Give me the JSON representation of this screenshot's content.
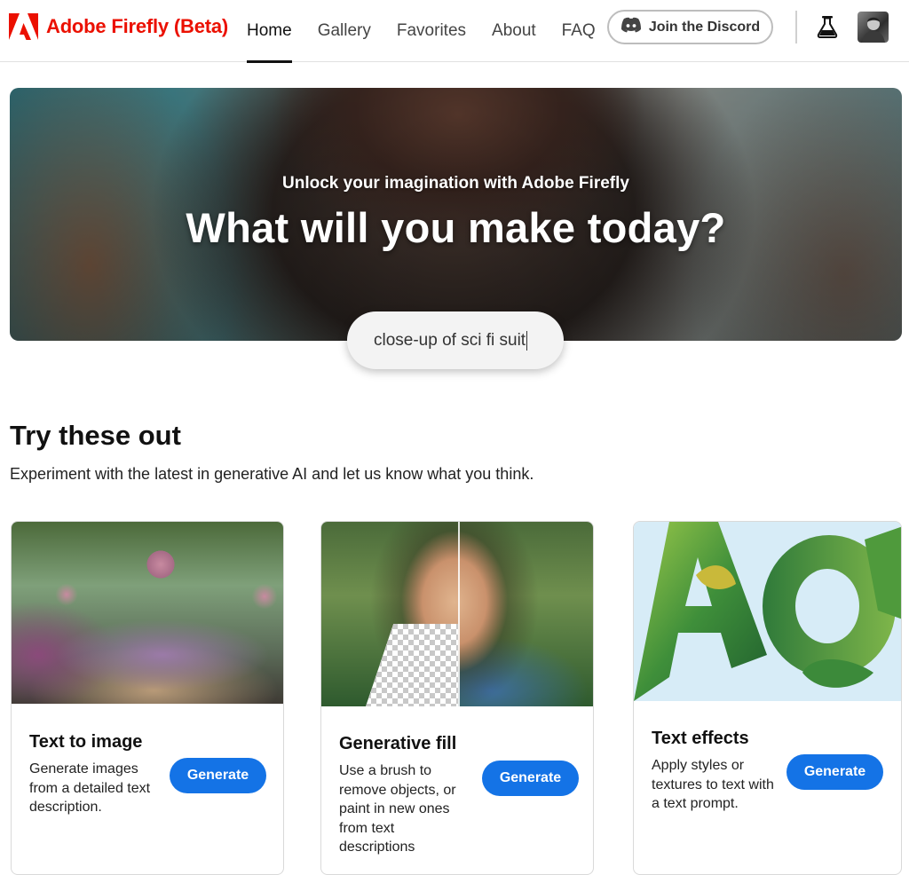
{
  "header": {
    "brand_name": "Adobe Firefly (Beta)",
    "brand_color": "#eb1000",
    "nav": [
      {
        "label": "Home",
        "active": true
      },
      {
        "label": "Gallery",
        "active": false
      },
      {
        "label": "Favorites",
        "active": false
      },
      {
        "label": "About",
        "active": false
      },
      {
        "label": "FAQ",
        "active": false
      }
    ],
    "discord_label": "Join the Discord",
    "icons": [
      "adobe-logo-icon",
      "discord-icon",
      "flask-icon",
      "avatar"
    ]
  },
  "hero": {
    "subtitle": "Unlock your imagination with Adobe Firefly",
    "title": "What will you make today?",
    "prompt_value": "close-up of sci fi suit"
  },
  "section": {
    "title": "Try these out",
    "description": "Experiment with the latest in generative AI and let us know what you think."
  },
  "cards": [
    {
      "title": "Text to image",
      "description": "Generate images from a detailed text description.",
      "button": "Generate"
    },
    {
      "title": "Generative fill",
      "description": "Use a brush to remove objects, or paint in new ones from text descriptions",
      "button": "Generate"
    },
    {
      "title": "Text effects",
      "description": "Apply styles or textures to text with a text prompt.",
      "button": "Generate"
    }
  ],
  "accent_color": "#1473e6"
}
